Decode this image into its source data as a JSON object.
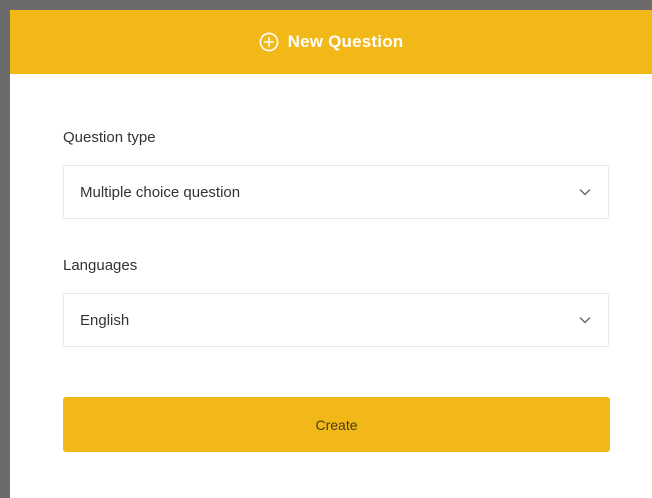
{
  "colors": {
    "accent": "#f2b817",
    "frame": "#6b6b6b",
    "border": "#e6e6e6",
    "text": "#333333"
  },
  "dialog": {
    "title": "New Question",
    "title_icon": "plus-circle-icon"
  },
  "fields": {
    "question_type": {
      "label": "Question type",
      "value": "Multiple choice question",
      "icon": "chevron-down-icon"
    },
    "languages": {
      "label": "Languages",
      "value": "English",
      "icon": "chevron-down-icon"
    }
  },
  "actions": {
    "create_label": "Create"
  }
}
